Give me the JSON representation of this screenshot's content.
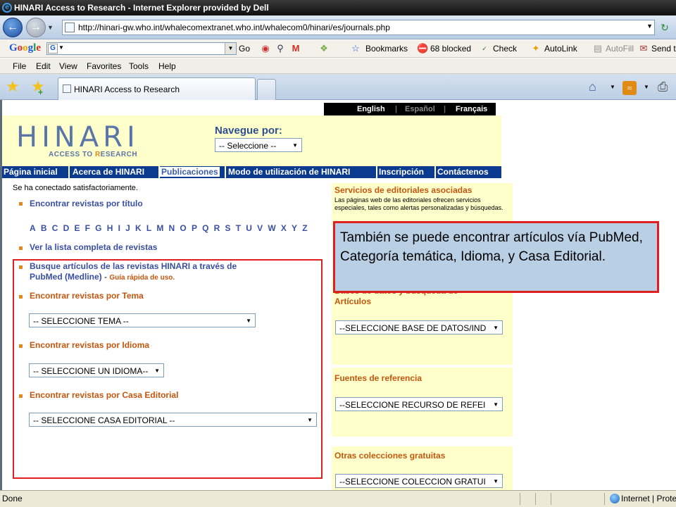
{
  "window": {
    "title": "HINARI Access to Research - Internet Explorer provided by Dell"
  },
  "address_bar": {
    "url": "http://hinari-gw.who.int/whalecomextranet.who.int/whalecom0/hinari/es/journals.php"
  },
  "google_toolbar": {
    "logo": "Google",
    "go": "Go",
    "bookmarks": "Bookmarks",
    "blocked": "68 blocked",
    "check": "Check",
    "autolink": "AutoLink",
    "autofill": "AutoFill",
    "sendto": "Send to"
  },
  "menu": [
    "File",
    "Edit",
    "View",
    "Favorites",
    "Tools",
    "Help"
  ],
  "tab": {
    "label": "HINARI Access to Research"
  },
  "site": {
    "languages": [
      "English",
      "Español",
      "Français"
    ],
    "logo_word": "HINARI",
    "logo_sub_1": "ACCESS TO ",
    "logo_sub_r": "R",
    "logo_sub_2": "ESEARCH",
    "navegue_label": "Navegue por:",
    "navegue_select": "-- Seleccione --",
    "nav": [
      "Página inicial",
      "Acerca de HINARI",
      "Publicaciones",
      "Modo de utilización de HINARI",
      "Inscripción",
      "Contáctenos"
    ],
    "status_msg": "Se ha conectado satisfactoriamente."
  },
  "main": {
    "find_by_title": "Encontrar revistas por título",
    "alphabet": [
      "A",
      "B",
      "C",
      "D",
      "E",
      "F",
      "G",
      "H",
      "I",
      "J",
      "K",
      "L",
      "M",
      "N",
      "O",
      "P",
      "Q",
      "R",
      "S",
      "T",
      "U",
      "V",
      "W",
      "X",
      "Y",
      "Z"
    ],
    "full_list": "Ver la lista completa de revistas",
    "pubmed_line1": "Busque artículos de las revistas HINARI a través de",
    "pubmed_line2": "PubMed (Medline)",
    "pubmed_dash": " - ",
    "quick_guide": "Guía rápida de uso.",
    "by_subject": "Encontrar revistas por Tema",
    "subject_select": "-- SELECCIONE TEMA --",
    "by_language": "Encontrar revistas por Idioma",
    "language_select": "-- SELECCIONE UN IDIOMA--",
    "by_publisher": "Encontrar revistas por Casa Editorial",
    "publisher_select": "-- SELECCIONE CASA EDITORIAL --"
  },
  "sidebar": {
    "publisher_services_title": "Servicios de editoriales asociadas",
    "publisher_services_text": "Las páginas web de las editoriales ofrecen servicios especiales, tales como alertas personalizadas y búsquedas.",
    "databases_title_line1": "Bases de datos y búsqueda de",
    "databases_title_line2": "Artículos",
    "databases_select": "--SELECCIONE BASE DE DATOS/IND",
    "reference_title": "Fuentes de referencia",
    "reference_select": "--SELECCIONE RECURSO DE REFEI",
    "free_title": "Otras colecciones gratuitas",
    "free_select": "--SELECCIONE COLECCION GRATUI"
  },
  "callout": {
    "text": "También se puede encontrar artículos vía PubMed,  Categoría temática, Idioma, y Casa Editorial."
  },
  "statusbar": {
    "done": "Done",
    "zone": "Internet | Protected"
  }
}
